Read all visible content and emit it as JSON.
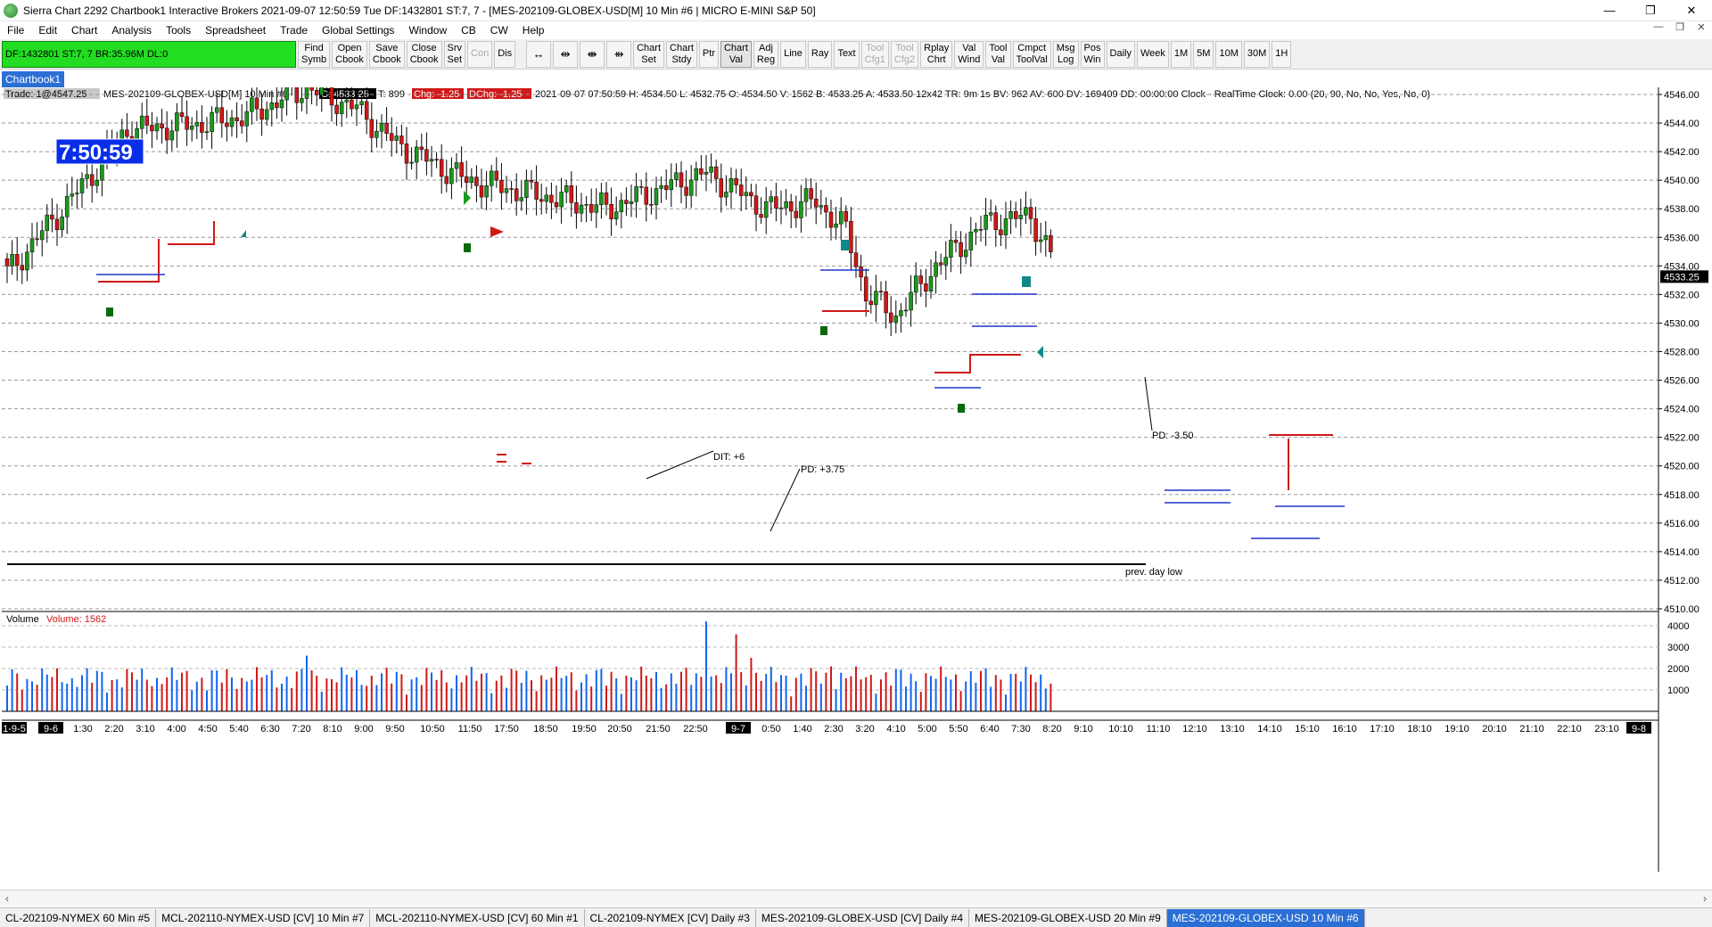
{
  "window": {
    "title": "Sierra Chart 2292 Chartbook1  Interactive Brokers 2021-09-07  12:50:59 Tue  DF:1432801  ST:7, 7 - [MES-202109-GLOBEX-USD[M]  10 Min  #6 | MICRO E-MINI S&P 50]",
    "minimize": "—",
    "maximize": "❐",
    "close": "✕"
  },
  "menu": [
    "File",
    "Edit",
    "Chart",
    "Analysis",
    "Tools",
    "Spreadsheet",
    "Trade",
    "Global Settings",
    "Window",
    "CB",
    "CW",
    "Help"
  ],
  "mdi": {
    "min": "—",
    "restore": "❐",
    "close": "✕"
  },
  "toolbar": {
    "status": "DF:1432801  ST:7, 7  BR:35.96M  DL:0",
    "buttons": [
      {
        "label": "Find\nSymb"
      },
      {
        "label": "Open\nCbook"
      },
      {
        "label": "Save\nCbook"
      },
      {
        "label": "Close\nCbook"
      },
      {
        "label": "Srv\nSet"
      },
      {
        "label": "Con",
        "disabled": true
      },
      {
        "label": "Dis"
      }
    ],
    "icon_buttons": [
      "↔",
      "⇹",
      "⇼",
      "⇻"
    ],
    "buttons2": [
      {
        "label": "Chart\nSet"
      },
      {
        "label": "Chart\nStdy"
      },
      {
        "label": "Ptr"
      },
      {
        "label": "Chart\nVal",
        "on": true
      },
      {
        "label": "Adj\nReg"
      },
      {
        "label": "Line"
      },
      {
        "label": "Ray"
      },
      {
        "label": "Text"
      },
      {
        "label": "Tool\nCfg1",
        "disabled": true
      },
      {
        "label": "Tool\nCfg2",
        "disabled": true
      },
      {
        "label": "Rplay\nChrt"
      },
      {
        "label": "Val\nWind"
      },
      {
        "label": "Tool\nVal"
      },
      {
        "label": "Cmpct\nToolVal"
      },
      {
        "label": "Msg\nLog"
      },
      {
        "label": "Pos\nWin"
      },
      {
        "label": "Daily"
      },
      {
        "label": "Week"
      },
      {
        "label": "1M"
      },
      {
        "label": "5M"
      },
      {
        "label": "10M"
      },
      {
        "label": "30M"
      },
      {
        "label": "1H"
      }
    ]
  },
  "chartbook_tab": "Chartbook1",
  "chart": {
    "header": {
      "trade": "Trade: 1@4547.25",
      "symbol": "MES-202109-GLOBEX-USD[M]  10 Min  #6",
      "close": "C: 4533.25",
      "ticks": "T: 899",
      "chg": "Chg: -1.25",
      "dchg": "DChg: -1.25",
      "info": "2021-09-07 07:50:59 H: 4534.50 L: 4532.75 O: 4534.50 V: 1562 B: 4533.25 A: 4533.50 12x42 TR: 9m 1s BV: 962 AV: 600 DV: 169409 DD: 00:00:00 Clock - RealTime  Clock: 0.00   (20, 90, No, No, Yes, No, 0)"
    },
    "clock": "7:50:59",
    "price_labels": [
      "4546.00",
      "4544.00",
      "4542.00",
      "4540.00",
      "4538.00",
      "4536.00",
      "4534.00",
      "4532.00",
      "4530.00",
      "4528.00",
      "4526.00",
      "4524.00",
      "4522.00",
      "4520.00",
      "4518.00",
      "4516.00",
      "4514.00",
      "4512.00",
      "4510.00"
    ],
    "current_price": "4533.25",
    "annotations": {
      "dit": "DIT: +6",
      "pd1": "PD: +3.75",
      "pd2": "PD: -3.50",
      "prev_low": "prev. day low"
    },
    "volume_header": {
      "title": "Volume",
      "value": "Volume: 1562"
    },
    "volume_labels": [
      "4000",
      "3000",
      "2000",
      "1000"
    ],
    "time_labels": [
      "1-9-5",
      "9-6",
      "1:30",
      "2:20",
      "3:10",
      "4:00",
      "4:50",
      "5:40",
      "6:30",
      "7:20",
      "8:10",
      "9:00",
      "9:50",
      "10:50",
      "11:50",
      "17:50",
      "18:50",
      "19:50",
      "20:50",
      "21:50",
      "22:50",
      "9-7",
      "0:50",
      "1:40",
      "2:30",
      "3:20",
      "4:10",
      "5:00",
      "5:50",
      "6:40",
      "7:30",
      "8:20",
      "9:10",
      "10:10",
      "11:10",
      "12:10",
      "13:10",
      "14:10",
      "15:10",
      "16:10",
      "17:10",
      "18:10",
      "19:10",
      "20:10",
      "21:10",
      "22:10",
      "23:10",
      "9-8"
    ]
  },
  "bottom_tabs": [
    {
      "label": "CL-202109-NYMEX  60 Min  #5"
    },
    {
      "label": "MCL-202110-NYMEX-USD [CV]  10 Min  #7"
    },
    {
      "label": "MCL-202110-NYMEX-USD [CV]  60 Min  #1"
    },
    {
      "label": "CL-202109-NYMEX [CV]  Daily  #3"
    },
    {
      "label": "MES-202109-GLOBEX-USD [CV]  Daily  #4"
    },
    {
      "label": "MES-202109-GLOBEX-USD  20 Min  #9"
    },
    {
      "label": "MES-202109-GLOBEX-USD  10 Min  #6",
      "active": true
    }
  ],
  "colors": {
    "up": "#1a9a1a",
    "down": "#d01818",
    "accent": "#2b6fd4",
    "status_bg": "#22dd22",
    "clock_bg": "#0a2ee8"
  }
}
